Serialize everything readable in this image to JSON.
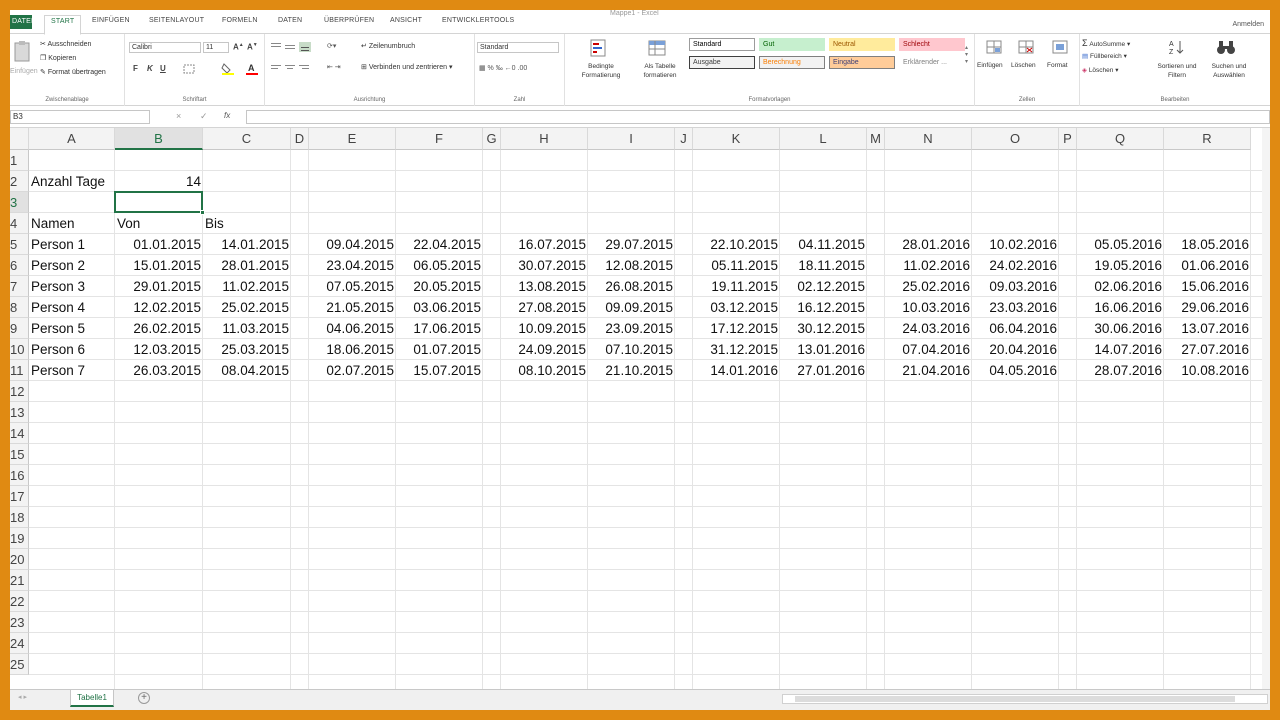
{
  "window": {
    "title": "Mappe1 - Excel",
    "signin": "Anmelden"
  },
  "tabs": [
    {
      "label": "DATEI",
      "kind": "file"
    },
    {
      "label": "START",
      "kind": "active"
    },
    {
      "label": "EINFÜGEN"
    },
    {
      "label": "SEITENLAYOUT"
    },
    {
      "label": "FORMELN"
    },
    {
      "label": "DATEN"
    },
    {
      "label": "ÜBERPRÜFEN"
    },
    {
      "label": "ANSICHT"
    },
    {
      "label": "ENTWICKLERTOOLS"
    }
  ],
  "ribbon": {
    "clipboard": {
      "paste": "Einfügen",
      "cut": "Ausschneiden",
      "copy": "Kopieren",
      "format_painter": "Format übertragen",
      "label": "Zwischenablage"
    },
    "font": {
      "name": "Calibri",
      "size": "11",
      "label": "Schriftart",
      "bold": "F",
      "italic": "K",
      "underline": "U"
    },
    "alignment": {
      "wrap": "Zeilenumbruch",
      "merge": "Verbinden und zentrieren",
      "label": "Ausrichtung"
    },
    "number": {
      "format": "Standard",
      "label": "Zahl"
    },
    "styles": {
      "conditional": "Bedingte Formatierung",
      "as_table": "Als Tabelle formatieren",
      "cells": [
        {
          "text": "Standard",
          "bg": "#ffffff",
          "fg": "#000000",
          "border": "#9c9c9c"
        },
        {
          "text": "Gut",
          "bg": "#c6efce",
          "fg": "#006100",
          "border": "#c6efce"
        },
        {
          "text": "Neutral",
          "bg": "#ffeb9c",
          "fg": "#9c5700",
          "border": "#ffeb9c"
        },
        {
          "text": "Schlecht",
          "bg": "#ffc7ce",
          "fg": "#9c0006",
          "border": "#ffc7ce"
        },
        {
          "text": "Ausgabe",
          "bg": "#f2f2f2",
          "fg": "#3f3f3f",
          "border": "#3f3f3f"
        },
        {
          "text": "Berechnung",
          "bg": "#f2f2f2",
          "fg": "#fa7d00",
          "border": "#7f7f7f"
        },
        {
          "text": "Eingabe",
          "bg": "#ffcc99",
          "fg": "#3f3f76",
          "border": "#7f7f7f"
        },
        {
          "text": "Erklärender ...",
          "bg": "#ffffff",
          "fg": "#7f7f7f",
          "border": "#ffffff"
        }
      ],
      "label": "Formatvorlagen"
    },
    "cells": {
      "insert": "Einfügen",
      "delete": "Löschen",
      "format": "Format",
      "label": "Zellen"
    },
    "editing": {
      "autosum": "AutoSumme",
      "fill": "Füllbereich",
      "clear": "Löschen",
      "sort": "Sortieren und Filtern",
      "find": "Suchen und Auswählen",
      "label": "Bearbeiten"
    }
  },
  "formula_bar": {
    "name_box": "B3",
    "cancel": "×",
    "enter": "✓",
    "fx": "fx",
    "value": ""
  },
  "grid": {
    "columns": [
      "A",
      "B",
      "C",
      "D",
      "E",
      "F",
      "G",
      "H",
      "I",
      "J",
      "K",
      "L",
      "M",
      "N",
      "O",
      "P",
      "Q",
      "R"
    ],
    "selected_column": "B",
    "selected_row": 3,
    "rows": [
      "1",
      "2",
      "3",
      "4",
      "5",
      "6",
      "7",
      "8",
      "9",
      "10",
      "11",
      "12",
      "13",
      "14",
      "15",
      "16",
      "17",
      "18",
      "19",
      "20",
      "21",
      "22",
      "23",
      "24",
      "25"
    ],
    "label_days": "Anzahl Tage",
    "days": "14",
    "header_names": "Namen",
    "header_from": "Von",
    "header_to": "Bis",
    "people": [
      {
        "name": "Person 1",
        "dates": [
          "01.01.2015",
          "14.01.2015",
          "09.04.2015",
          "22.04.2015",
          "16.07.2015",
          "29.07.2015",
          "22.10.2015",
          "04.11.2015",
          "28.01.2016",
          "10.02.2016",
          "05.05.2016",
          "18.05.2016"
        ]
      },
      {
        "name": "Person 2",
        "dates": [
          "15.01.2015",
          "28.01.2015",
          "23.04.2015",
          "06.05.2015",
          "30.07.2015",
          "12.08.2015",
          "05.11.2015",
          "18.11.2015",
          "11.02.2016",
          "24.02.2016",
          "19.05.2016",
          "01.06.2016"
        ]
      },
      {
        "name": "Person 3",
        "dates": [
          "29.01.2015",
          "11.02.2015",
          "07.05.2015",
          "20.05.2015",
          "13.08.2015",
          "26.08.2015",
          "19.11.2015",
          "02.12.2015",
          "25.02.2016",
          "09.03.2016",
          "02.06.2016",
          "15.06.2016"
        ]
      },
      {
        "name": "Person 4",
        "dates": [
          "12.02.2015",
          "25.02.2015",
          "21.05.2015",
          "03.06.2015",
          "27.08.2015",
          "09.09.2015",
          "03.12.2015",
          "16.12.2015",
          "10.03.2016",
          "23.03.2016",
          "16.06.2016",
          "29.06.2016"
        ]
      },
      {
        "name": "Person 5",
        "dates": [
          "26.02.2015",
          "11.03.2015",
          "04.06.2015",
          "17.06.2015",
          "10.09.2015",
          "23.09.2015",
          "17.12.2015",
          "30.12.2015",
          "24.03.2016",
          "06.04.2016",
          "30.06.2016",
          "13.07.2016"
        ]
      },
      {
        "name": "Person 6",
        "dates": [
          "12.03.2015",
          "25.03.2015",
          "18.06.2015",
          "01.07.2015",
          "24.09.2015",
          "07.10.2015",
          "31.12.2015",
          "13.01.2016",
          "07.04.2016",
          "20.04.2016",
          "14.07.2016",
          "27.07.2016"
        ]
      },
      {
        "name": "Person 7",
        "dates": [
          "26.03.2015",
          "08.04.2015",
          "02.07.2015",
          "15.07.2015",
          "08.10.2015",
          "21.10.2015",
          "14.01.2016",
          "27.01.2016",
          "21.04.2016",
          "04.05.2016",
          "28.07.2016",
          "10.08.2016"
        ]
      }
    ]
  },
  "sheet_tabs": [
    {
      "label": "Tabelle1"
    }
  ],
  "add_sheet": "+"
}
